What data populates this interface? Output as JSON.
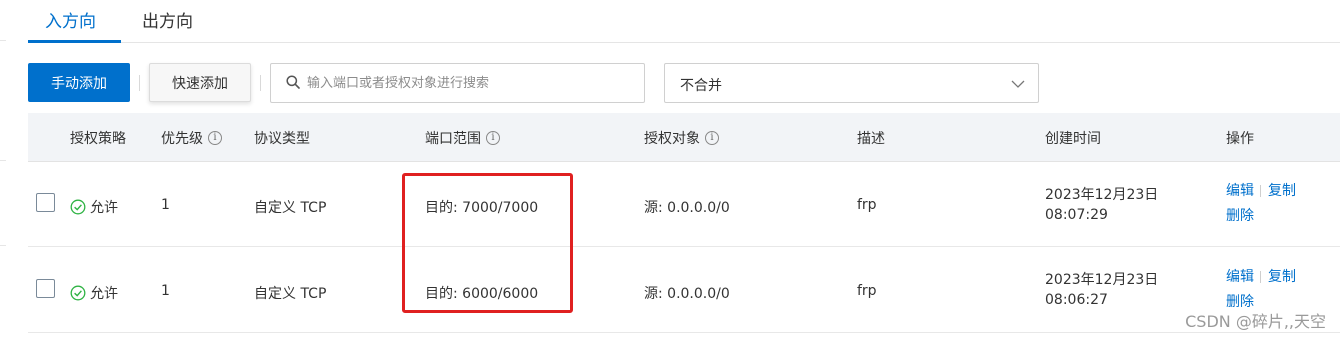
{
  "tabs": [
    {
      "label": "入方向",
      "active": true
    },
    {
      "label": "出方向",
      "active": false
    }
  ],
  "toolbar": {
    "manual_add_label": "手动添加",
    "quick_add_label": "快速添加",
    "search_placeholder": "输入端口或者授权对象进行搜索",
    "merge_select_value": "不合并"
  },
  "table": {
    "headers": {
      "policy": "授权策略",
      "priority": "优先级",
      "protocol": "协议类型",
      "port_range": "端口范围",
      "auth_object": "授权对象",
      "description": "描述",
      "created_time": "创建时间",
      "actions": "操作"
    },
    "rows": [
      {
        "policy": "允许",
        "priority": "1",
        "protocol": "自定义 TCP",
        "port_range": "目的: 7000/7000",
        "auth_object": "源: 0.0.0.0/0",
        "description": "frp",
        "created_date": "2023年12月23日",
        "created_clock": "08:07:29",
        "edit": "编辑",
        "copy": "复制",
        "delete": "删除"
      },
      {
        "policy": "允许",
        "priority": "1",
        "protocol": "自定义 TCP",
        "port_range": "目的: 6000/6000",
        "auth_object": "源: 0.0.0.0/0",
        "description": "frp",
        "created_date": "2023年12月23日",
        "created_clock": "08:06:27",
        "edit": "编辑",
        "copy": "复制",
        "delete": "删除"
      }
    ]
  },
  "watermark": "CSDN @碎片,,天空",
  "colors": {
    "accent": "#0070cc",
    "highlight": "#e02020",
    "success": "#2fb344"
  },
  "icons": [
    "search-icon",
    "chevron-down-icon",
    "info-icon",
    "check-circle-icon"
  ]
}
